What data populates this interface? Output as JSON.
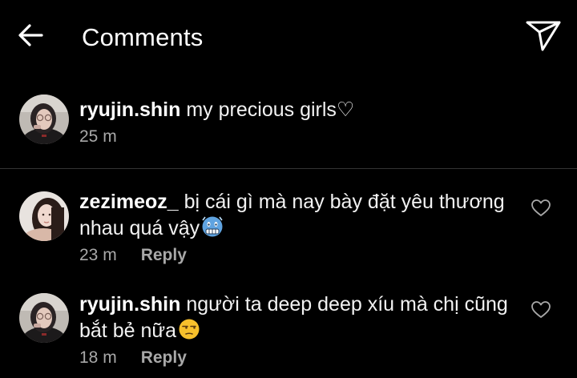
{
  "header": {
    "title": "Comments",
    "back_icon": "arrow-left-icon",
    "send_icon": "paper-plane-icon"
  },
  "caption": {
    "username": "ryujin.shin",
    "text": "my precious girls♡",
    "time": "25 m"
  },
  "comments": [
    {
      "username": "zezimeoz_",
      "text": "bị cái gì mà nay bày đặt yêu thương nhau quá vậy",
      "emoji": "cold-face-emoji",
      "time": "23 m",
      "reply_label": "Reply"
    },
    {
      "username": "ryujin.shin",
      "text": "người ta deep deep xíu mà chị cũng bắt bẻ nữa",
      "emoji": "unamused-face-emoji",
      "time": "18 m",
      "reply_label": "Reply"
    }
  ],
  "colors": {
    "background": "#000000",
    "text": "#ffffff",
    "meta": "#a8a8a8",
    "divider": "#333333"
  }
}
